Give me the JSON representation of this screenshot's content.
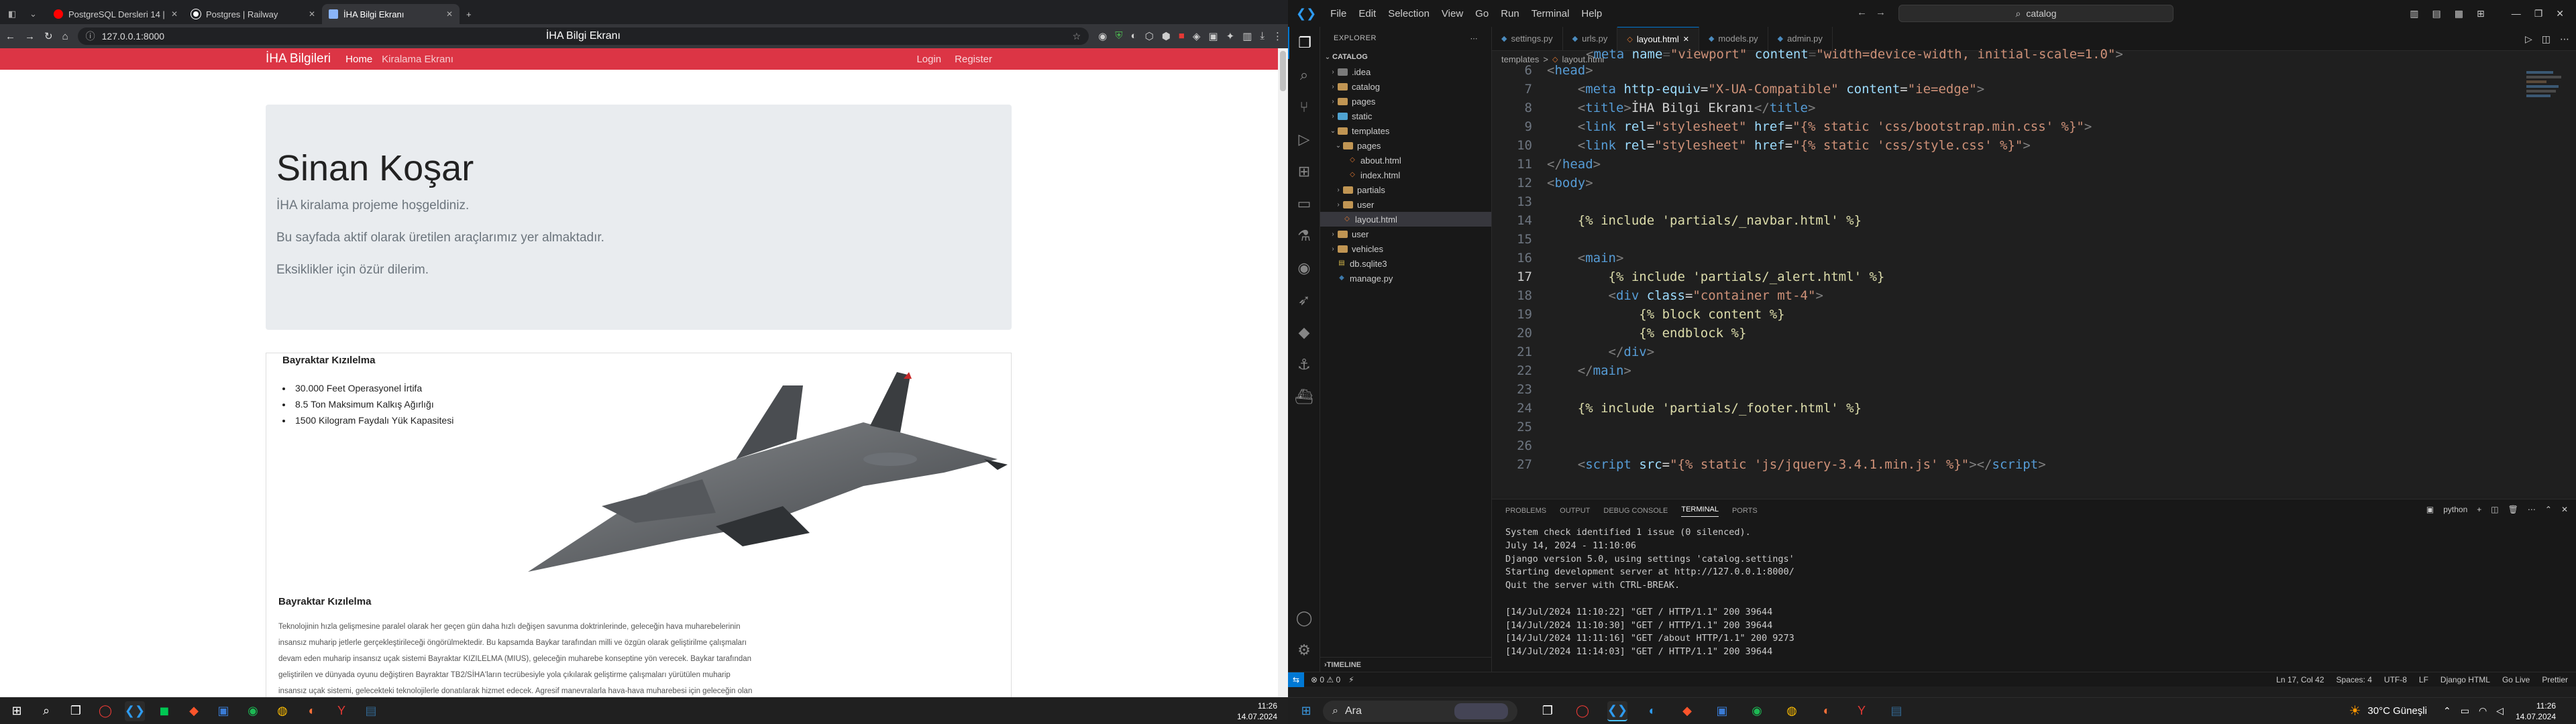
{
  "browser": {
    "tabs": [
      {
        "title": "PostgreSQL Dersleri 14 | S",
        "color": "#ff0000"
      },
      {
        "title": "Postgres | Railway",
        "color": "#ffffff"
      },
      {
        "title": "İHA Bilgi Ekranı",
        "color": "#8ab4f8"
      }
    ],
    "url": "127.0.0.1:8000",
    "page_title": "İHA Bilgi Ekranı",
    "new_tab": "+"
  },
  "site": {
    "brand": "İHA Bilgileri",
    "nav": [
      "Home",
      "Kiralama Ekranı"
    ],
    "nav_right": [
      "Login",
      "Register"
    ],
    "jumbo": {
      "name": "Sinan Koşar",
      "lines": [
        "İHA kiralama projeme hoşgeldiniz.",
        "Bu sayfada aktif olarak üretilen araçlarımız yer almaktadır.",
        "Eksiklikler için özür dilerim."
      ]
    },
    "card": {
      "title": "Bayraktar Kızılelma",
      "features": [
        "30.000 Feet Operasyonel İrtifa",
        "8.5 Ton Maksimum Kalkış Ağırlığı",
        "1500 Kilogram Faydalı Yük Kapasitesi"
      ],
      "subtitle": "Bayraktar Kızılelma",
      "para_lines": [
        "Teknolojinin hızla gelişmesine paralel olarak her geçen gün daha hızlı değişen savunma doktrinlerinde, geleceğin hava muharebelerinin",
        "insansız muharip jetlerle gerçekleştirileceği öngörülmektedir. Bu kapsamda Baykar tarafından milli ve özgün olarak geliştirilme çalışmaları",
        "devam eden muharip insansız uçak sistemi Bayraktar KIZILELMA (MIUS), geleceğin muharebe konseptine yön verecek. Baykar tarafından",
        "geliştirilen ve dünyada oyunu değiştiren Bayraktar TB2/SİHA'ların tecrübesiyle yola çıkılarak geliştirme çalışmaları yürütülen muharip",
        "insansız uçak sistemi, gelecekteki teknolojilerle donatılarak hizmet edecek. Agresif manevralarla hava-hava muharebesi için geleceğin olan"
      ]
    }
  },
  "taskbar_left": {
    "time": "11:26",
    "date": "14.07.2024"
  },
  "vscode": {
    "menu": [
      "File",
      "Edit",
      "Selection",
      "View",
      "Go",
      "Run",
      "Terminal",
      "Help"
    ],
    "search": "catalog",
    "explorer_title": "EXPLORER",
    "root": "CATALOG",
    "tree": [
      {
        "name": ".idea",
        "depth": 1,
        "type": "folder",
        "color": "#7a7a7a",
        "open": false
      },
      {
        "name": "catalog",
        "depth": 1,
        "type": "folder",
        "color": "#c09553",
        "open": false
      },
      {
        "name": "pages",
        "depth": 1,
        "type": "folder",
        "color": "#c09553",
        "open": false
      },
      {
        "name": "static",
        "depth": 1,
        "type": "folder",
        "color": "#4fa3d1",
        "open": false
      },
      {
        "name": "templates",
        "depth": 1,
        "type": "folder",
        "color": "#c09553",
        "open": true
      },
      {
        "name": "pages",
        "depth": 2,
        "type": "folder",
        "color": "#c09553",
        "open": true
      },
      {
        "name": "about.html",
        "depth": 3,
        "type": "html",
        "color": "#e37933"
      },
      {
        "name": "index.html",
        "depth": 3,
        "type": "html",
        "color": "#e37933"
      },
      {
        "name": "partials",
        "depth": 2,
        "type": "folder",
        "color": "#c09553",
        "open": false
      },
      {
        "name": "user",
        "depth": 2,
        "type": "folder",
        "color": "#c09553",
        "open": false
      },
      {
        "name": "layout.html",
        "depth": 2,
        "type": "html",
        "color": "#e37933",
        "selected": true
      },
      {
        "name": "user",
        "depth": 1,
        "type": "folder",
        "color": "#c09553",
        "open": false
      },
      {
        "name": "vehicles",
        "depth": 1,
        "type": "folder",
        "color": "#c09553",
        "open": false
      },
      {
        "name": "db.sqlite3",
        "depth": 1,
        "type": "db",
        "color": "#d4b84a"
      },
      {
        "name": "manage.py",
        "depth": 1,
        "type": "py",
        "color": "#3c78aa"
      }
    ],
    "tabs": [
      {
        "name": "settings.py",
        "color": "#4b8bbe",
        "active": false
      },
      {
        "name": "urls.py",
        "color": "#4b8bbe",
        "active": false
      },
      {
        "name": "layout.html",
        "color": "#e37933",
        "active": true
      },
      {
        "name": "models.py",
        "color": "#4b8bbe",
        "active": false
      },
      {
        "name": "admin.py",
        "color": "#4b8bbe",
        "active": false
      }
    ],
    "breadcrumb": [
      "templates",
      ">",
      "layout.html"
    ],
    "line_numbers": [
      "6",
      "7",
      "8",
      "9",
      "10",
      "11",
      "12",
      "13",
      "14",
      "15",
      "16",
      "17",
      "18",
      "19",
      "20",
      "21",
      "22",
      "23",
      "24",
      "25",
      "26",
      "27"
    ],
    "panel_tabs": [
      "PROBLEMS",
      "OUTPUT",
      "DEBUG CONSOLE",
      "TERMINAL",
      "PORTS"
    ],
    "terminal_label": "python",
    "terminal": [
      "System check identified 1 issue (0 silenced).",
      "July 14, 2024 - 11:10:06",
      "Django version 5.0, using settings 'catalog.settings'",
      "Starting development server at http://127.0.0.1:8000/",
      "Quit the server with CTRL-BREAK.",
      "",
      "[14/Jul/2024 11:10:22] \"GET / HTTP/1.1\" 200 39644",
      "[14/Jul/2024 11:10:30] \"GET / HTTP/1.1\" 200 39644",
      "[14/Jul/2024 11:11:16] \"GET /about HTTP/1.1\" 200 9273",
      "[14/Jul/2024 11:14:03] \"GET / HTTP/1.1\" 200 39644"
    ],
    "timeline": "TIMELINE",
    "status_left": "⊗ 0 ⚠ 0",
    "status_right": [
      "Ln 17, Col 42",
      "Spaces: 4",
      "UTF-8",
      "LF",
      "Django HTML",
      "Go Live",
      "Prettier"
    ]
  },
  "taskbar_right": {
    "search": "Ara",
    "weather": "30°C Güneşli",
    "time": "11:26",
    "date": "14.07.2024"
  }
}
